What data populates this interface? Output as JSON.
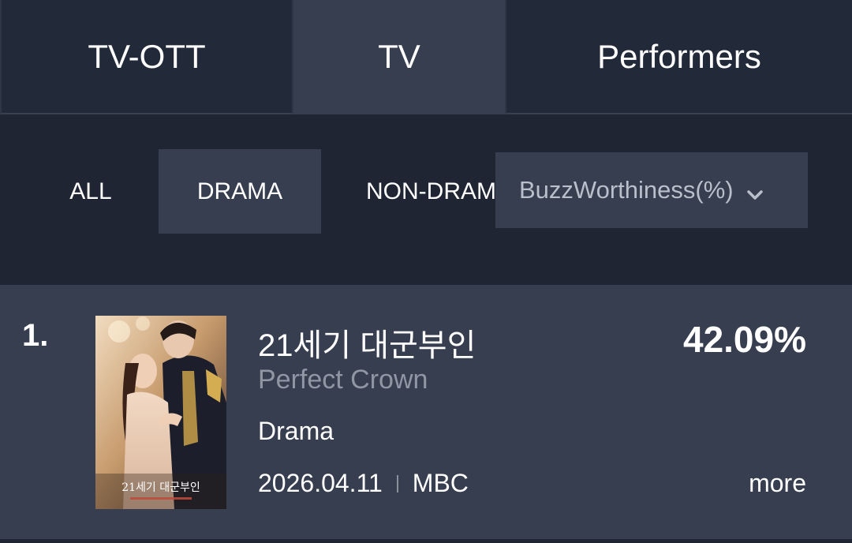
{
  "tabs": [
    {
      "label": "TV-OTT",
      "active": false
    },
    {
      "label": "TV",
      "active": true
    },
    {
      "label": "Performers",
      "active": false
    }
  ],
  "filters": {
    "chips": [
      {
        "label": "ALL",
        "active": false
      },
      {
        "label": "DRAMA",
        "active": true
      },
      {
        "label": "NON-DRAMA",
        "active": false
      }
    ],
    "sort_select": {
      "value": "BuzzWorthiness(%)",
      "icon": "chevron-down-icon"
    }
  },
  "ranking": [
    {
      "rank": "1.",
      "title_ko": "21세기 대군부인",
      "title_en": "Perfect Crown",
      "genre": "Drama",
      "date": "2026.04.11",
      "network": "MBC",
      "percent": "42.09%",
      "more_label": "more",
      "poster_text": "21세기 대군부인"
    }
  ],
  "colors": {
    "background": "#1f2533",
    "active_bg": "#373e4f",
    "muted_text": "#9096a3",
    "select_text": "#b9bfcb"
  }
}
